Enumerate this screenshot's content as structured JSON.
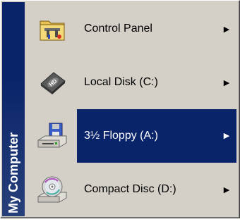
{
  "sidebar": {
    "title": "My Computer"
  },
  "menu": {
    "items": [
      {
        "label": "Control Panel",
        "icon": "control-panel-icon",
        "selected": false
      },
      {
        "label": "Local Disk (C:)",
        "icon": "hard-disk-icon",
        "selected": false
      },
      {
        "label": "3½ Floppy (A:)",
        "icon": "floppy-drive-icon",
        "selected": true
      },
      {
        "label": "Compact Disc (D:)",
        "icon": "cd-drive-icon",
        "selected": false
      }
    ]
  },
  "colors": {
    "menu_bg": "#d4d0c8",
    "selection_bg": "#0a246a",
    "selection_text": "#ffffff",
    "side_band": "#0a246a"
  }
}
